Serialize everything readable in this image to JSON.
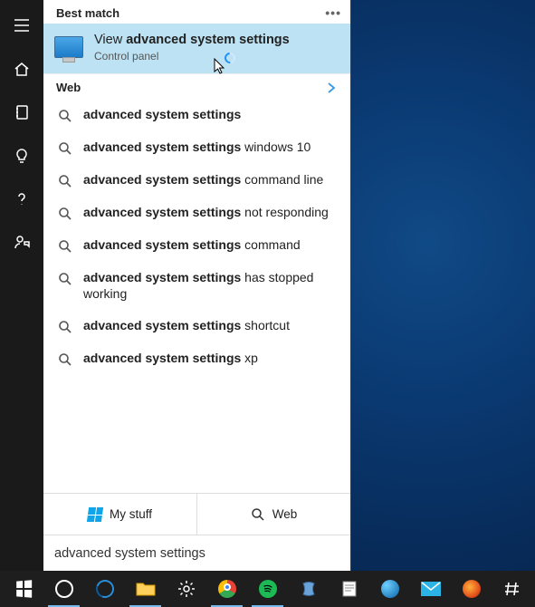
{
  "ribbon": {
    "items": [
      {
        "name": "hamburger-icon"
      },
      {
        "name": "home-icon"
      },
      {
        "name": "notebook-icon"
      },
      {
        "name": "lightbulb-icon"
      },
      {
        "name": "help-icon"
      },
      {
        "name": "feedback-icon"
      }
    ]
  },
  "headers": {
    "best_match": "Best match",
    "web": "Web"
  },
  "best_match": {
    "prefix": "View ",
    "bold": "advanced system settings",
    "subtitle": "Control panel"
  },
  "suggestions": [
    {
      "bold": "advanced system settings",
      "rest": ""
    },
    {
      "bold": "advanced system settings",
      "rest": " windows 10"
    },
    {
      "bold": "advanced system settings",
      "rest": " command line"
    },
    {
      "bold": "advanced system settings",
      "rest": " not responding"
    },
    {
      "bold": "advanced system settings",
      "rest": " command"
    },
    {
      "bold": "advanced system settings",
      "rest": " has stopped working"
    },
    {
      "bold": "advanced system settings",
      "rest": " shortcut"
    },
    {
      "bold": "advanced system settings",
      "rest": " xp"
    }
  ],
  "scope": {
    "my_stuff": "My stuff",
    "web": "Web"
  },
  "search_value": "advanced system settings",
  "taskbar": {
    "items": [
      {
        "name": "start-button"
      },
      {
        "name": "cortana-button"
      },
      {
        "name": "edge-icon"
      },
      {
        "name": "file-explorer-icon"
      },
      {
        "name": "settings-icon"
      },
      {
        "name": "chrome-icon"
      },
      {
        "name": "spotify-icon"
      },
      {
        "name": "vs-icon"
      },
      {
        "name": "notepad-icon"
      },
      {
        "name": "teams-icon"
      },
      {
        "name": "mail-icon"
      },
      {
        "name": "firefox-icon"
      },
      {
        "name": "slack-icon"
      }
    ]
  }
}
